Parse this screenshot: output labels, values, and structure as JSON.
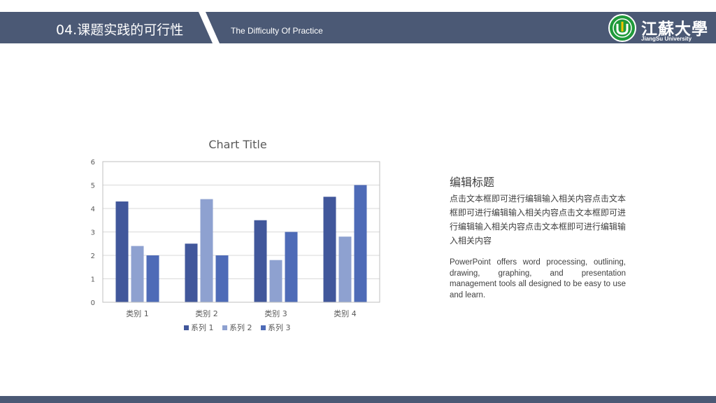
{
  "header": {
    "title": "04.课题实践的可行性",
    "subtitle": "The Difficulty Of Practice",
    "logo_text": "江蘇大學",
    "logo_subtext": "JiangSu University"
  },
  "colors": {
    "header_bg": "#4b5975",
    "series_1": "#41579b",
    "series_2": "#8ea1d0",
    "series_3": "#4e6bb7",
    "logo_green": "#1f9a3a"
  },
  "chart_data": {
    "type": "bar",
    "title": "Chart Title",
    "categories": [
      "类别 1",
      "类别 2",
      "类别 3",
      "类别 4"
    ],
    "series": [
      {
        "name": "系列 1",
        "values": [
          4.3,
          2.5,
          3.5,
          4.5
        ]
      },
      {
        "name": "系列 2",
        "values": [
          2.4,
          4.4,
          1.8,
          2.8
        ]
      },
      {
        "name": "系列 3",
        "values": [
          2,
          2,
          3,
          5
        ]
      }
    ],
    "ylim": [
      0,
      6
    ],
    "yticks": [
      "0",
      "1",
      "2",
      "3",
      "4",
      "5",
      "6"
    ],
    "grid": true,
    "legend_position": "bottom"
  },
  "text_block": {
    "heading": "编辑标题",
    "body_cn": "点击文本框即可进行编辑输入相关内容点击文本框即可进行编辑输入相关内容点击文本框即可进行编辑输入相关内容点击文本框即可进行编辑输入相关内容",
    "body_en": "PowerPoint offers word processing, outlining, drawing, graphing, and presentation management tools all designed to be easy to use and learn."
  }
}
